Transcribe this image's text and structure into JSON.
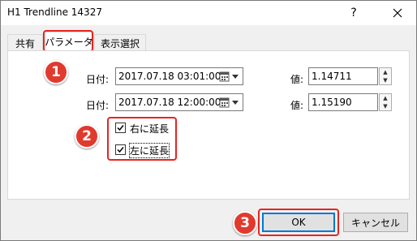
{
  "window": {
    "title": "H1 Trendline 14327",
    "help_label": "?",
    "close_icon": "close-icon"
  },
  "tabs": [
    {
      "label": "共有",
      "active": false
    },
    {
      "label": "パラメータ",
      "active": true
    },
    {
      "label": "表示選択",
      "active": false
    }
  ],
  "params": {
    "row1": {
      "date_label": "日付:",
      "date_value": "2017.07.18 03:01:00",
      "value_label": "値:",
      "value": "1.14711"
    },
    "row2": {
      "date_label": "日付:",
      "date_value": "2017.07.18 12:00:00",
      "value_label": "値:",
      "value": "1.15190"
    },
    "extend_right": {
      "label": "右に延長",
      "checked": true
    },
    "extend_left": {
      "label": "左に延長",
      "checked": true
    }
  },
  "buttons": {
    "ok": "OK",
    "cancel": "キャンセル"
  },
  "annotations": {
    "badge1": "1",
    "badge2": "2",
    "badge3": "3",
    "color": "#e03a2e"
  }
}
